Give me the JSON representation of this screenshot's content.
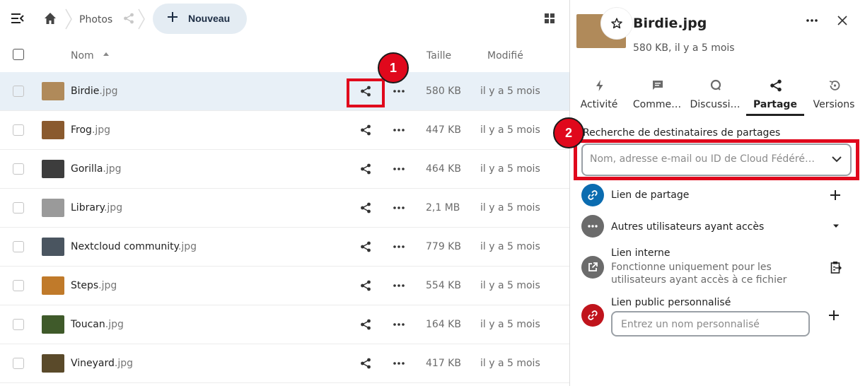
{
  "breadcrumb": {
    "folder": "Photos"
  },
  "toolbar": {
    "new_label": "Nouveau"
  },
  "columns": {
    "name": "Nom",
    "size": "Taille",
    "modified": "Modifié"
  },
  "files": [
    {
      "base": "Birdie",
      "ext": ".jpg",
      "size": "580 KB",
      "modified": "il y a 5 mois",
      "thumb": "#b08a5a",
      "selected": true
    },
    {
      "base": "Frog",
      "ext": ".jpg",
      "size": "447 KB",
      "modified": "il y a 5 mois",
      "thumb": "#8a5a2e"
    },
    {
      "base": "Gorilla",
      "ext": ".jpg",
      "size": "464 KB",
      "modified": "il y a 5 mois",
      "thumb": "#3d3d3d"
    },
    {
      "base": "Library",
      "ext": ".jpg",
      "size": "2,1 MB",
      "modified": "il y a 5 mois",
      "thumb": "#9a9a9a"
    },
    {
      "base": "Nextcloud community",
      "ext": ".jpg",
      "size": "779 KB",
      "modified": "il y a 5 mois",
      "thumb": "#4a5560"
    },
    {
      "base": "Steps",
      "ext": ".jpg",
      "size": "554 KB",
      "modified": "il y a 5 mois",
      "thumb": "#c07a2a"
    },
    {
      "base": "Toucan",
      "ext": ".jpg",
      "size": "164 KB",
      "modified": "il y a 5 mois",
      "thumb": "#3f5a2a"
    },
    {
      "base": "Vineyard",
      "ext": ".jpg",
      "size": "417 KB",
      "modified": "il y a 5 mois",
      "thumb": "#5a4a2a"
    }
  ],
  "annotations": {
    "step1": "1",
    "step2": "2",
    "color": "#e0081c"
  },
  "sidebar": {
    "title": "Birdie.jpg",
    "subtitle": "580 KB, il y a 5 mois",
    "thumb": "#b08a5a",
    "tabs": [
      {
        "label": "Activité",
        "icon": "flash-icon"
      },
      {
        "label": "Comme…",
        "icon": "comment-icon"
      },
      {
        "label": "Discussi…",
        "icon": "discussion-icon"
      },
      {
        "label": "Partage",
        "icon": "share-icon",
        "active": true
      },
      {
        "label": "Versions",
        "icon": "history-icon"
      }
    ],
    "search": {
      "label": "Recherche de destinataires de partages",
      "placeholder": "Nom, adresse e-mail ou ID de Cloud Fédéré…"
    },
    "shares": {
      "link": {
        "title": "Lien de partage",
        "color": "#0b6cb0"
      },
      "others": {
        "title": "Autres utilisateurs ayant accès",
        "color": "#6b6b6b"
      },
      "internal": {
        "title": "Lien interne",
        "desc": "Fonctionne uniquement pour les utilisateurs ayant accès à ce fichier",
        "color": "#6b6b6b"
      },
      "custom": {
        "title": "Lien public personnalisé",
        "placeholder": "Entrez un nom personnalisé",
        "color": "#c0141c"
      }
    }
  }
}
